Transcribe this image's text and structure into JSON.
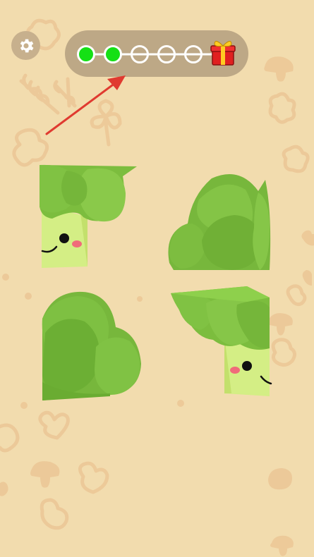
{
  "game": {
    "settings_icon": "gear-icon",
    "progress": {
      "total_steps": 5,
      "completed_steps": 2,
      "reward_icon": "gift-icon"
    },
    "hint_icon": "arrow-icon",
    "puzzle": {
      "subject": "broccoli",
      "pieces": [
        {
          "id": "top-left",
          "content": "broccoli-face-left"
        },
        {
          "id": "top-right",
          "content": "broccoli-florets"
        },
        {
          "id": "bottom-left",
          "content": "broccoli-florets"
        },
        {
          "id": "bottom-right",
          "content": "broccoli-face-right"
        }
      ]
    },
    "colors": {
      "background": "#f2dcae",
      "background_icons": "#ebc998",
      "progress_done": "#15e015",
      "broccoli_dark": "#6fb23a",
      "broccoli_light": "#d4ee85",
      "arrow": "#e03a30"
    }
  }
}
